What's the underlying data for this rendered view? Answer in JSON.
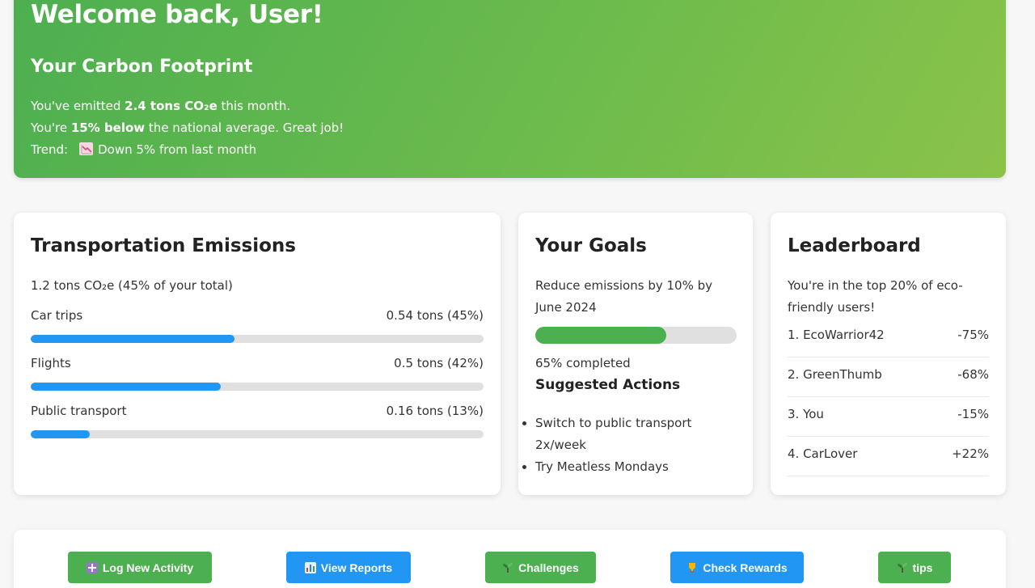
{
  "hero": {
    "welcome": "Welcome back, User!",
    "subtitle": "Your Carbon Footprint",
    "line1_pre": "You've emitted ",
    "line1_bold": "2.4 tons CO₂e",
    "line1_post": " this month.",
    "line2_pre": "You're ",
    "line2_bold": "15% below",
    "line2_post": " the national average. Great job!",
    "trend_label": "Trend:",
    "trend_icon": "chart-decreasing-icon",
    "trend_text": "Down 5% from last month"
  },
  "transport": {
    "title": "Transportation Emissions",
    "summary": "1.2 tons CO₂e (45% of your total)",
    "rows": [
      {
        "label": "Car trips",
        "value": "0.54 tons (45%)",
        "fraction": 0.45
      },
      {
        "label": "Flights",
        "value": "0.5 tons (42%)",
        "fraction": 0.42
      },
      {
        "label": "Public transport",
        "value": "0.16 tons (13%)",
        "fraction": 0.13
      }
    ],
    "bar_color": "#2196f3"
  },
  "goals": {
    "title": "Your Goals",
    "goal_line1": "Reduce emissions by 10% by",
    "goal_line2": "June 2024",
    "progress": 0.65,
    "progress_text": "65% completed",
    "actions_title": "Suggested Actions",
    "actions": [
      "Switch to public transport 2x/week",
      "Try Meatless Mondays"
    ],
    "bar_color": "#4caf50"
  },
  "leaderboard": {
    "title": "Leaderboard",
    "intro_line1": "You're in the top 20% of eco-",
    "intro_line2": "friendly users!",
    "rows": [
      {
        "name": "1. EcoWarrior42",
        "pct": "-75%"
      },
      {
        "name": "2. GreenThumb",
        "pct": "-68%"
      },
      {
        "name": "3. You",
        "pct": "-15%"
      },
      {
        "name": "4. CarLover",
        "pct": "+22%"
      }
    ]
  },
  "buttons": [
    {
      "label": "Log New Activity",
      "icon": "plus-icon",
      "color": "green"
    },
    {
      "label": "View Reports",
      "icon": "bar-chart-icon",
      "color": "blue"
    },
    {
      "label": "Challenges",
      "icon": "seedling-icon",
      "color": "green"
    },
    {
      "label": "Check Rewards",
      "icon": "trophy-icon",
      "color": "blue"
    },
    {
      "label": "tips",
      "icon": "seedling-icon",
      "color": "green"
    }
  ],
  "colors": {
    "accent_green": "#4caf50",
    "accent_blue": "#2196f3",
    "hero_end": "#8bc34a"
  }
}
